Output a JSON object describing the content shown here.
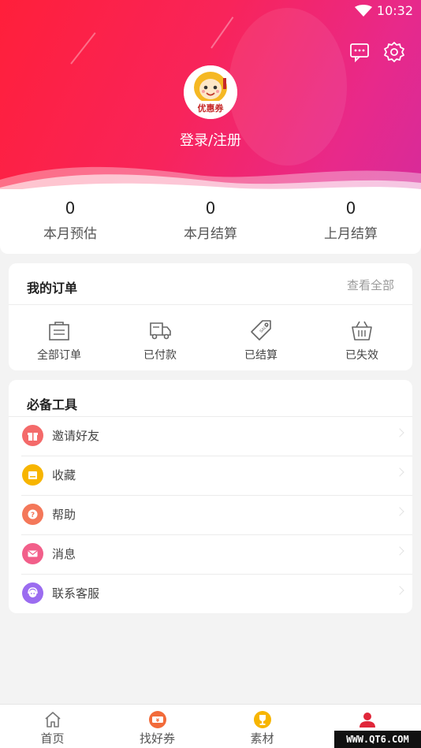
{
  "statusbar": {
    "time": "10:32"
  },
  "header": {
    "login_label": "登录/注册",
    "avatar_text": "优惠券",
    "colors": {
      "gradient_start": "#ff1f3a",
      "gradient_end": "#d72a9a"
    }
  },
  "stats": [
    {
      "value": "0",
      "label": "本月预估"
    },
    {
      "value": "0",
      "label": "本月结算"
    },
    {
      "value": "0",
      "label": "上月结算"
    }
  ],
  "orders": {
    "title": "我的订单",
    "view_all": "查看全部",
    "items": [
      {
        "label": "全部订单",
        "icon": "shopping-bag-icon"
      },
      {
        "label": "已付款",
        "icon": "delivery-truck-icon"
      },
      {
        "label": "已结算",
        "icon": "sale-tag-icon"
      },
      {
        "label": "已失效",
        "icon": "basket-icon"
      }
    ]
  },
  "tools": {
    "title": "必备工具",
    "items": [
      {
        "label": "邀请好友",
        "icon": "gift-icon",
        "color": "#f46a6a"
      },
      {
        "label": "收藏",
        "icon": "folder-icon",
        "color": "#f7b500"
      },
      {
        "label": "帮助",
        "icon": "help-icon",
        "color": "#f4785a"
      },
      {
        "label": "消息",
        "icon": "mail-icon",
        "color": "#f25f8a"
      },
      {
        "label": "联系客服",
        "icon": "customer-service-icon",
        "color": "#9b6cf0"
      }
    ]
  },
  "tabbar": {
    "items": [
      {
        "label": "首页",
        "icon": "home-icon"
      },
      {
        "label": "找好券",
        "icon": "coupon-icon"
      },
      {
        "label": "素材",
        "icon": "trophy-icon"
      },
      {
        "label": "",
        "icon": "user-icon"
      }
    ],
    "active_color": "#e0273a"
  },
  "watermark": "WWW.QT6.COM"
}
